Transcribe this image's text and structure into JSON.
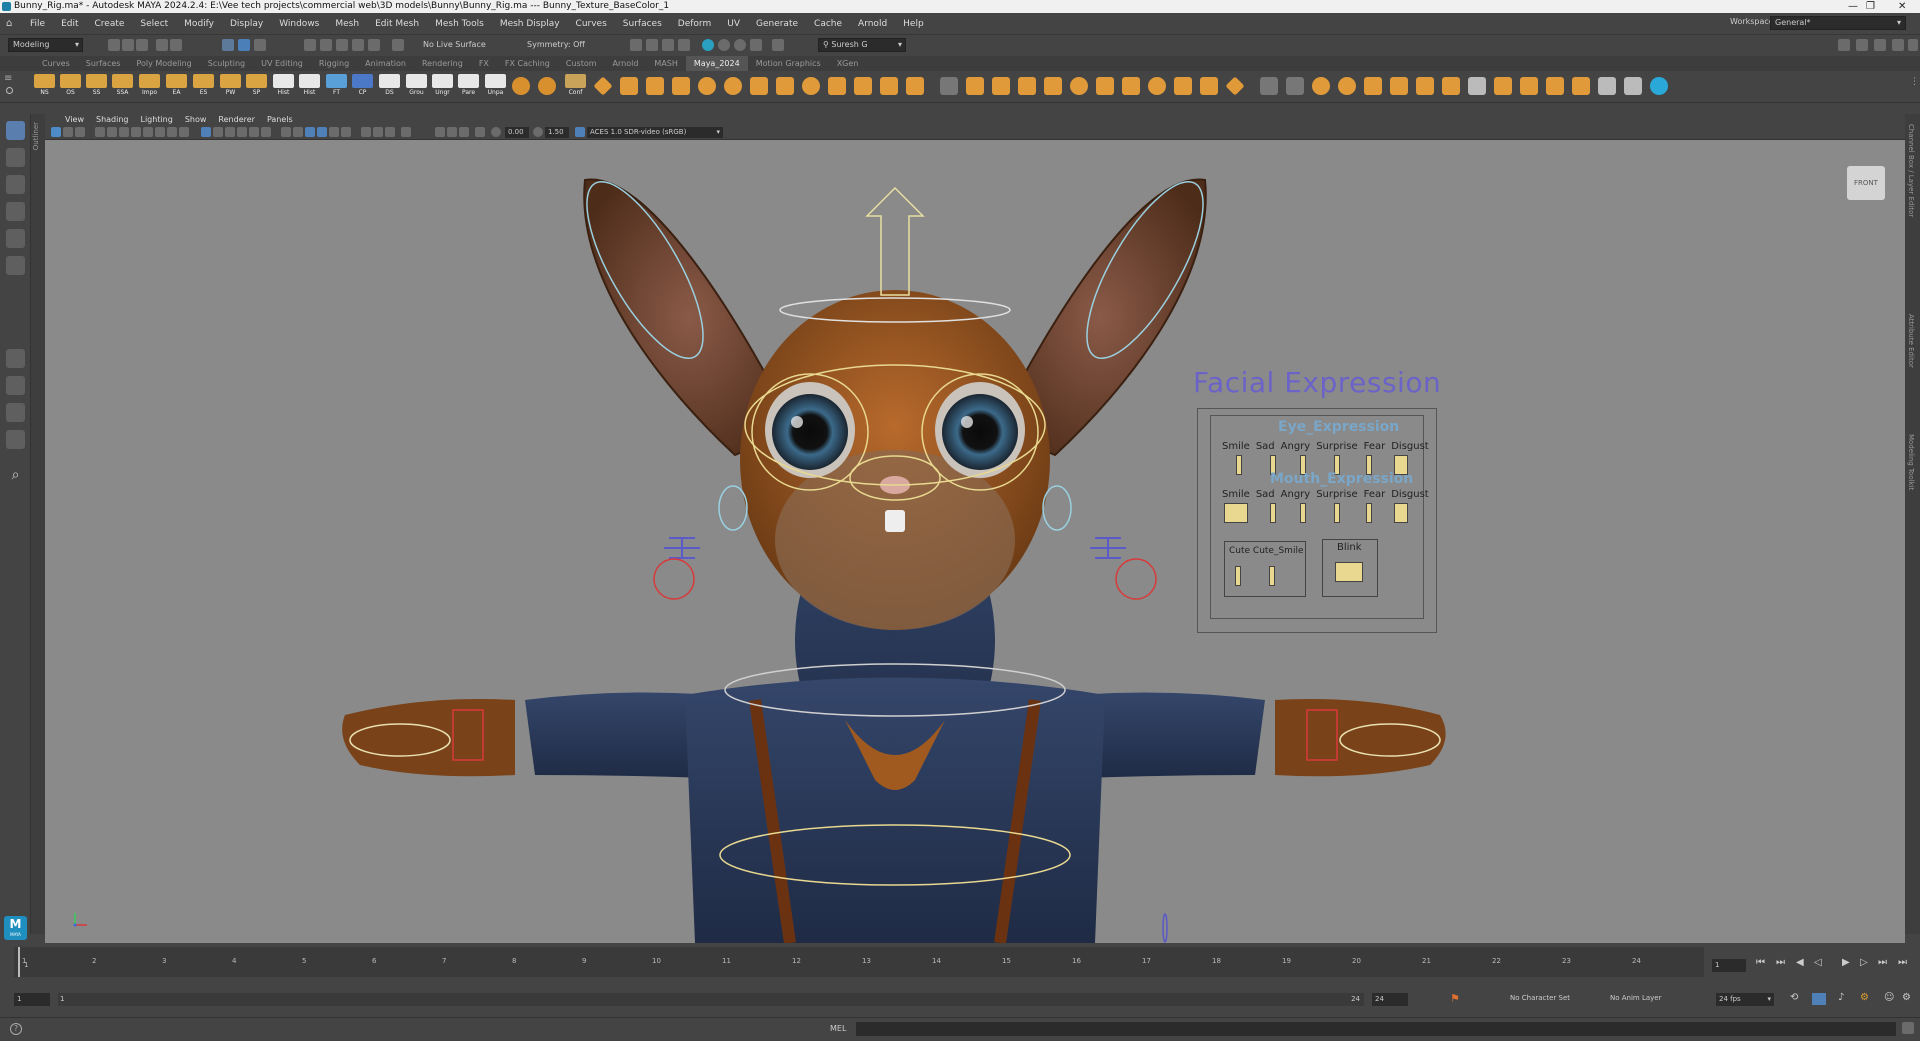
{
  "window": {
    "title": "Bunny_Rig.ma* - Autodesk MAYA 2024.2.4: E:\\Vee tech projects\\commercial web\\3D models\\Bunny\\Bunny_Rig.ma  ---  Bunny_Texture_BaseColor_1"
  },
  "menu": [
    "File",
    "Edit",
    "Create",
    "Select",
    "Modify",
    "Display",
    "Windows",
    "Mesh",
    "Edit Mesh",
    "Mesh Tools",
    "Mesh Display",
    "Curves",
    "Surfaces",
    "Deform",
    "UV",
    "Generate",
    "Cache",
    "Arnold",
    "Help"
  ],
  "workspace": {
    "label": "Workspace:",
    "value": "General*"
  },
  "status": {
    "mode": "Modeling",
    "live_surface": "No Live Surface",
    "symmetry": "Symmetry: Off",
    "user": "Suresh G"
  },
  "shelf_tabs": [
    "Curves",
    "Surfaces",
    "Poly Modeling",
    "Sculpting",
    "UV Editing",
    "Rigging",
    "Animation",
    "Rendering",
    "FX",
    "FX Caching",
    "Custom",
    "Arnold",
    "MASH",
    "Maya_2024",
    "Motion Graphics",
    "XGen"
  ],
  "shelf_active_tab": "Maya_2024",
  "shelf_buttons": [
    "NS",
    "OS",
    "SS",
    "SSA",
    "Impo",
    "EA",
    "ES",
    "PW",
    "SP",
    "Hist",
    "Hist",
    "FT",
    "CP",
    "DS",
    "Grou",
    "Ungr",
    "Pare",
    "Unpa",
    "Conf"
  ],
  "panel_menu": [
    "View",
    "Shading",
    "Lighting",
    "Show",
    "Renderer",
    "Panels"
  ],
  "panel_toolbar": {
    "exposure": "0.00",
    "gamma": "1.50",
    "colorspace": "ACES 1.0 SDR-video (sRGB)"
  },
  "outliner_label": "Outliner",
  "right_strip": [
    "Channel Box / Layer Editor",
    "Attribute Editor",
    "Modeling Toolkit"
  ],
  "viewport": {
    "camera_label": "FRONT",
    "facial_panel": {
      "title": "Facial Expression",
      "eye_title": "Eye_Expression",
      "mouth_title": "Mouth_Expression",
      "eye_labels": [
        "Smile",
        "Sad",
        "Angry",
        "Surprise",
        "Fear",
        "Disgust"
      ],
      "mouth_labels": [
        "Smile",
        "Sad",
        "Angry",
        "Surprise",
        "Fear",
        "Disgust"
      ],
      "cute_label": "Cute Cute_Smile",
      "blink_label": "Blink"
    }
  },
  "timeline": {
    "ticks": [
      "1",
      "2",
      "3",
      "4",
      "5",
      "6",
      "7",
      "8",
      "9",
      "10",
      "11",
      "12",
      "13",
      "14",
      "15",
      "16",
      "17",
      "18",
      "19",
      "20",
      "21",
      "22",
      "23",
      "24"
    ],
    "current_frame": "1",
    "current_marker": "1"
  },
  "range": {
    "start": "1",
    "inner_start": "1",
    "inner_end": "24",
    "end": "24",
    "character_set": "No Character Set",
    "anim_layer": "No Anim Layer",
    "fps": "24 fps"
  },
  "command": {
    "lang": "MEL"
  },
  "logo": {
    "text": "M",
    "sub": "MAYA"
  }
}
